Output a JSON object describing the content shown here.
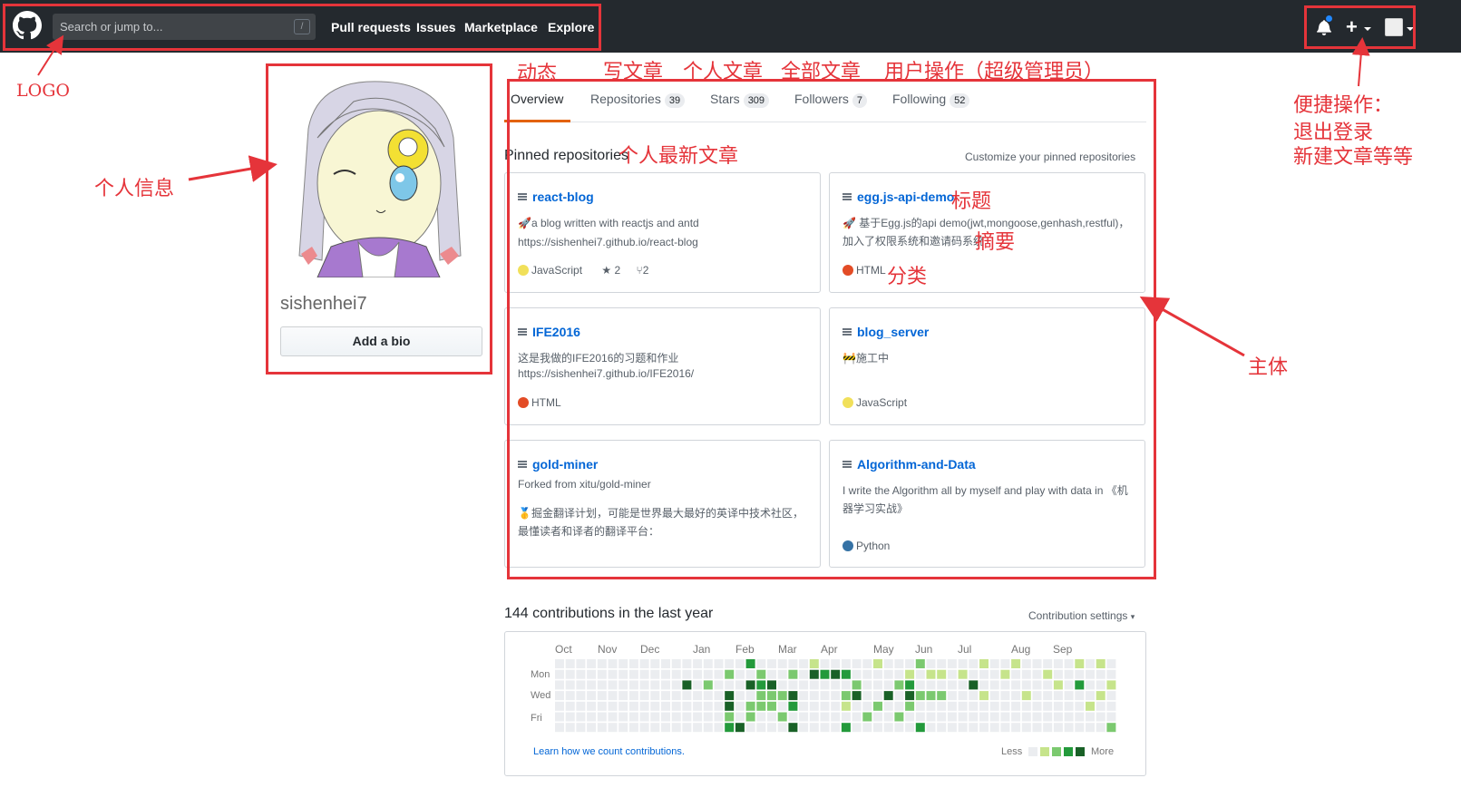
{
  "header": {
    "search_placeholder": "Search or jump to...",
    "search_shortcut": "/",
    "nav": [
      "Pull requests",
      "Issues",
      "Marketplace",
      "Explore"
    ],
    "plus_label": "+"
  },
  "profile": {
    "username": "sishenhei7",
    "bio_button": "Add a bio"
  },
  "tabs": [
    {
      "label": "Overview",
      "count": null
    },
    {
      "label": "Repositories",
      "count": "39"
    },
    {
      "label": "Stars",
      "count": "309"
    },
    {
      "label": "Followers",
      "count": "7"
    },
    {
      "label": "Following",
      "count": "52"
    }
  ],
  "pinned": {
    "title": "Pinned repositories",
    "customize": "Customize your pinned repositories",
    "cards": [
      {
        "name": "react-blog",
        "desc": "🚀a blog written with reactjs and antd",
        "desc2": "https://sishenhei7.github.io/react-blog",
        "lang": "JavaScript",
        "lang_color": "#f1e05a",
        "stars": "2",
        "forks": "2"
      },
      {
        "name": "egg.js-api-demo",
        "desc": "🚀 基于Egg.js的api demo(jwt,mongoose,genhash,restful)，加入了权限系统和邀请码系统",
        "lang": "HTML",
        "lang_color": "#e34c26"
      },
      {
        "name": "IFE2016",
        "desc": "这是我做的IFE2016的习题和作业",
        "desc2": "https://sishenhei7.github.io/IFE2016/",
        "lang": "HTML",
        "lang_color": "#e34c26"
      },
      {
        "name": "blog_server",
        "desc": "🚧施工中",
        "lang": "JavaScript",
        "lang_color": "#f1e05a"
      },
      {
        "name": "gold-miner",
        "forked": "Forked from xitu/gold-miner",
        "desc": "🥇掘金翻译计划，可能是世界最大最好的英译中技术社区，最懂读者和译者的翻译平台：",
        "lang": "",
        "lang_color": ""
      },
      {
        "name": "Algorithm-and-Data",
        "desc": "I write the Algorithm all by myself and play with data in 《机器学习实战》",
        "lang": "Python",
        "lang_color": "#3572A5"
      }
    ]
  },
  "contributions": {
    "title": "144 contributions in the last year",
    "settings": "Contribution settings",
    "months": [
      "Oct",
      "Nov",
      "Dec",
      "Jan",
      "Feb",
      "Mar",
      "Apr",
      "May",
      "Jun",
      "Jul",
      "Aug",
      "Sep"
    ],
    "days": [
      "Mon",
      "Wed",
      "Fri"
    ],
    "learn_link": "Learn how we count contributions.",
    "less": "Less",
    "more": "More",
    "colors": [
      "#ebedf0",
      "#c6e48b",
      "#7bc96f",
      "#239a3b",
      "#196127"
    ]
  },
  "annotations": {
    "logo": "LOGO",
    "profile_info": "个人信息",
    "dynamic": "动态",
    "write_article": "写文章",
    "personal_article": "个人文章",
    "all_articles": "全部文章",
    "user_ops": "用户操作（超级管理员）",
    "latest_articles": "个人最新文章",
    "title_label": "标题",
    "summary_label": "摘要",
    "category_label": "分类",
    "main_body": "主体",
    "quick_ops_1": "便捷操作：",
    "quick_ops_2": "退出登录",
    "quick_ops_3": "新建文章等等",
    "color": "#e5343a"
  }
}
